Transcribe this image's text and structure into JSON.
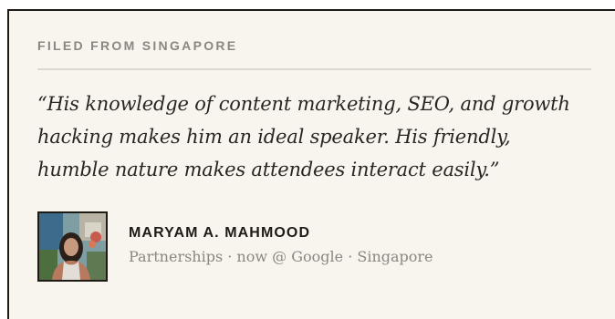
{
  "testimonial": {
    "eyebrow": "FILED FROM SINGAPORE",
    "quote": "“His knowledge of content marketing, SEO, and growth hacking makes him an ideal speaker. His friendly, humble nature makes attendees interact easily.”",
    "author": {
      "name": "MARYAM A. MAHMOOD",
      "meta": "Partnerships · now @ Google · Singapore"
    }
  },
  "colors": {
    "card_background": "#f8f5ef",
    "border": "#1e1a16",
    "muted_text": "#8b8680",
    "quote_text": "#2a2521",
    "divider": "#dcd7cf"
  },
  "icons": {
    "avatar": "person-photo"
  }
}
